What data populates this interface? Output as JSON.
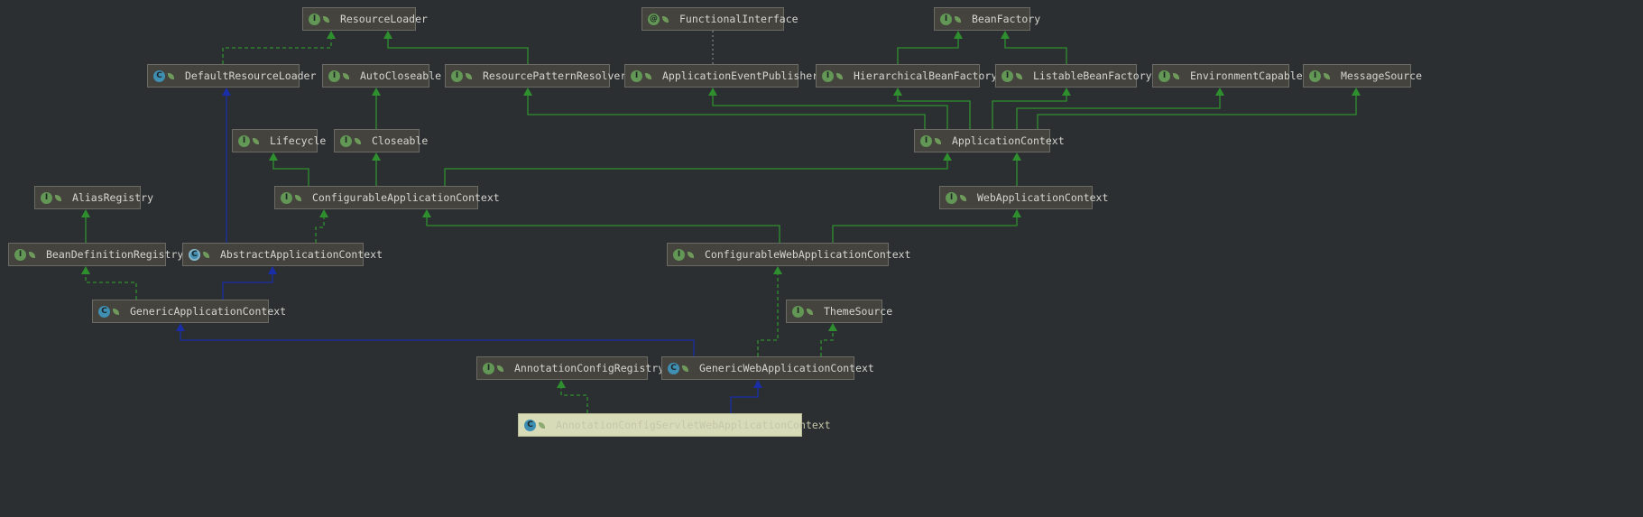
{
  "diagram": {
    "nodes": [
      {
        "id": "ResourceLoader",
        "label": "ResourceLoader",
        "kind": "interface",
        "icon_letter": "I"
      },
      {
        "id": "FunctionalInterface",
        "label": "FunctionalInterface",
        "kind": "annotation",
        "icon_letter": "@"
      },
      {
        "id": "BeanFactory",
        "label": "BeanFactory",
        "kind": "interface",
        "icon_letter": "I"
      },
      {
        "id": "DefaultResourceLoader",
        "label": "DefaultResourceLoader",
        "kind": "class",
        "icon_letter": "C"
      },
      {
        "id": "AutoCloseable",
        "label": "AutoCloseable",
        "kind": "interface",
        "icon_letter": "I"
      },
      {
        "id": "ResourcePatternResolver",
        "label": "ResourcePatternResolver",
        "kind": "interface",
        "icon_letter": "I"
      },
      {
        "id": "ApplicationEventPublisher",
        "label": "ApplicationEventPublisher",
        "kind": "interface",
        "icon_letter": "I"
      },
      {
        "id": "HierarchicalBeanFactory",
        "label": "HierarchicalBeanFactory",
        "kind": "interface",
        "icon_letter": "I"
      },
      {
        "id": "ListableBeanFactory",
        "label": "ListableBeanFactory",
        "kind": "interface",
        "icon_letter": "I"
      },
      {
        "id": "EnvironmentCapable",
        "label": "EnvironmentCapable",
        "kind": "interface",
        "icon_letter": "I"
      },
      {
        "id": "MessageSource",
        "label": "MessageSource",
        "kind": "interface",
        "icon_letter": "I"
      },
      {
        "id": "Lifecycle",
        "label": "Lifecycle",
        "kind": "interface",
        "icon_letter": "I"
      },
      {
        "id": "Closeable",
        "label": "Closeable",
        "kind": "interface",
        "icon_letter": "I"
      },
      {
        "id": "ApplicationContext",
        "label": "ApplicationContext",
        "kind": "interface",
        "icon_letter": "I"
      },
      {
        "id": "AliasRegistry",
        "label": "AliasRegistry",
        "kind": "interface",
        "icon_letter": "I"
      },
      {
        "id": "ConfigurableApplicationContext",
        "label": "ConfigurableApplicationContext",
        "kind": "interface",
        "icon_letter": "I"
      },
      {
        "id": "WebApplicationContext",
        "label": "WebApplicationContext",
        "kind": "interface",
        "icon_letter": "I"
      },
      {
        "id": "BeanDefinitionRegistry",
        "label": "BeanDefinitionRegistry",
        "kind": "interface",
        "icon_letter": "I"
      },
      {
        "id": "AbstractApplicationContext",
        "label": "AbstractApplicationContext",
        "kind": "abstract",
        "icon_letter": "C"
      },
      {
        "id": "ConfigurableWebApplicationContext",
        "label": "ConfigurableWebApplicationContext",
        "kind": "interface",
        "icon_letter": "I"
      },
      {
        "id": "GenericApplicationContext",
        "label": "GenericApplicationContext",
        "kind": "class",
        "icon_letter": "C"
      },
      {
        "id": "ThemeSource",
        "label": "ThemeSource",
        "kind": "interface",
        "icon_letter": "I"
      },
      {
        "id": "AnnotationConfigRegistry",
        "label": "AnnotationConfigRegistry",
        "kind": "interface",
        "icon_letter": "I"
      },
      {
        "id": "GenericWebApplicationContext",
        "label": "GenericWebApplicationContext",
        "kind": "class",
        "icon_letter": "C"
      },
      {
        "id": "AnnotationConfigServletWebApplicationContext",
        "label": "AnnotationConfigServletWebApplicationContext",
        "kind": "class",
        "icon_letter": "C",
        "selected": true
      }
    ],
    "edge_colors": {
      "interface_extends": "#2f8f2f",
      "implements": "#2f8f2f",
      "class_extends": "#1a2ea8",
      "annotation": "#7a7f84"
    }
  }
}
